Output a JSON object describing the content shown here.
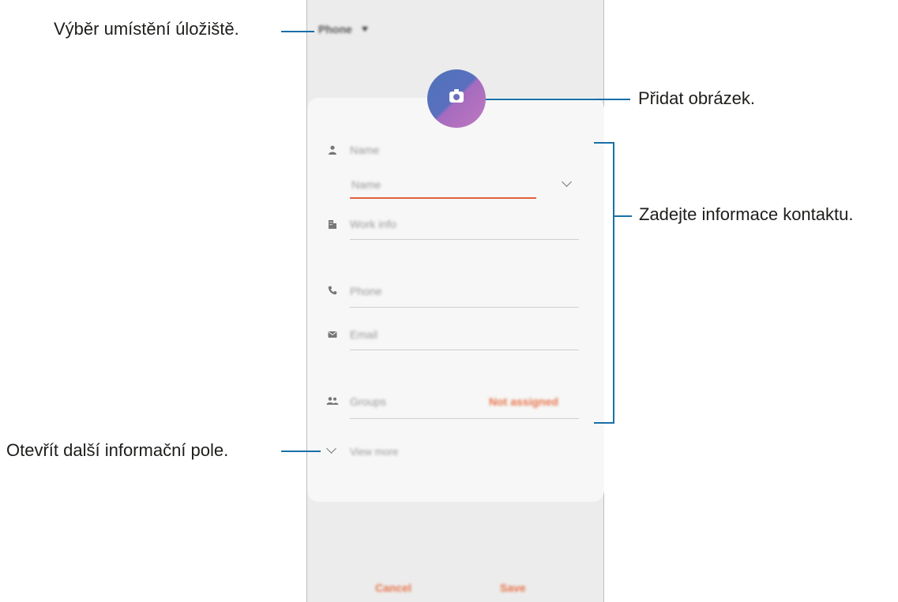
{
  "phone": {
    "storage_location": "Phone",
    "fields": {
      "name": "Name",
      "name_sub": "Name",
      "work_info": "Work info",
      "phone": "Phone",
      "email": "Email",
      "groups": "Groups",
      "groups_value": "Not assigned",
      "view_more": "View more"
    },
    "buttons": {
      "cancel": "Cancel",
      "save": "Save"
    },
    "accent_color": "#e8734a"
  },
  "annotations": {
    "storage": "Výběr umístění úložiště.",
    "add_image": "Přidat obrázek.",
    "contact_info": "Zadejte informace kontaktu.",
    "more_fields": "Otevřít další informační pole."
  }
}
